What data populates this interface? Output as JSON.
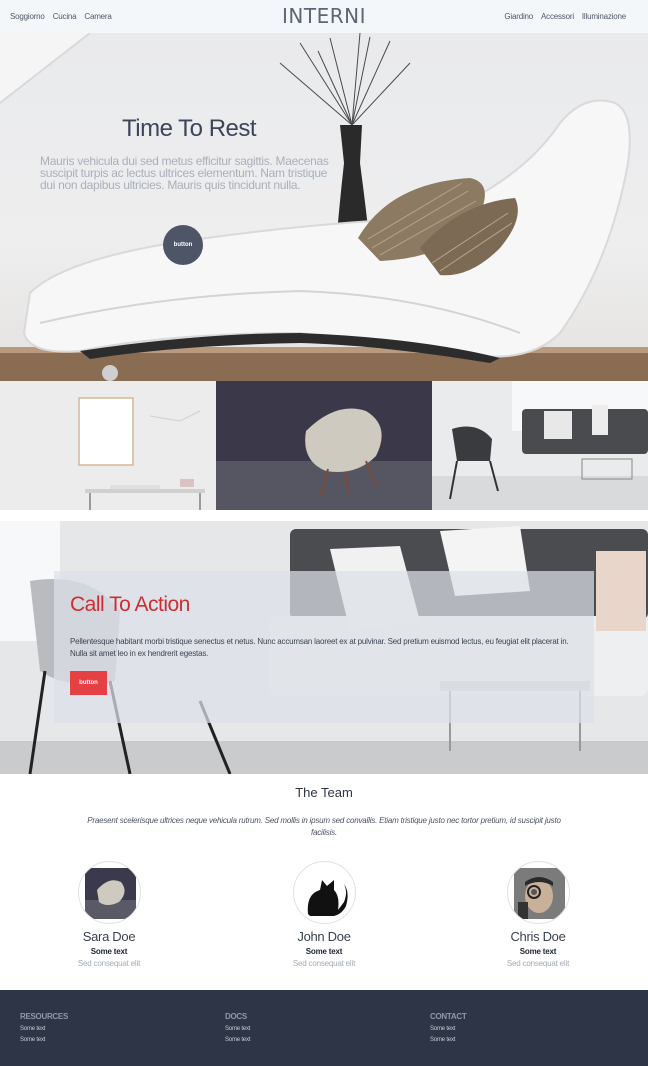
{
  "nav": {
    "left": [
      "Soggiorno",
      "Cucina",
      "Camera"
    ],
    "brand": "INTERNI",
    "right": [
      "Giardino",
      "Accessori",
      "Illuminazione"
    ]
  },
  "hero": {
    "title": "Time To Rest",
    "text": "Mauris vehicula dui sed metus efficitur sagittis. Maecenas suscipit turpis ac lectus ultrices elementum. Nam tristique dui non dapibus ultricies. Mauris quis tincidunt nulla.",
    "button": "button"
  },
  "cta": {
    "title": "Call To Action",
    "text": "Pellentesque habitant morbi tristique senectus et netus. Nunc accumsan laoreet ex at pulvinar. Sed pretium euismod lectus, eu feugiat elit placerat in. Nulla sit amet leo in ex hendrerit egestas.",
    "button": "button"
  },
  "team": {
    "title": "The Team",
    "description": "Praesent scelerisque ultrices neque vehicula rutrum. Sed mollis in ipsum sed convallis. Etiam tristique justo nec tortor pretium, id suscipit justo facilisis.",
    "members": [
      {
        "name": "Sara Doe",
        "role": "Some text",
        "sub": "Sed consequat elit"
      },
      {
        "name": "John Doe",
        "role": "Some text",
        "sub": "Sed consequat elit"
      },
      {
        "name": "Chris Doe",
        "role": "Some text",
        "sub": "Sed consequat elit"
      }
    ]
  },
  "footer": {
    "columns": [
      {
        "heading": "RESOURCES",
        "items": [
          "Some text",
          "Some text"
        ]
      },
      {
        "heading": "DOCS",
        "items": [
          "Some text",
          "Some text"
        ]
      },
      {
        "heading": "CONTACT",
        "items": [
          "Some text",
          "Some text"
        ]
      }
    ]
  },
  "colors": {
    "accent": "#e54043",
    "footer_bg": "#2d3546",
    "hero_button": "#4d5567"
  }
}
